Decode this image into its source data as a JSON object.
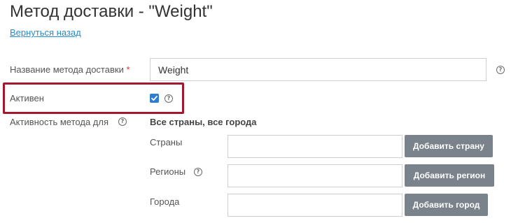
{
  "page": {
    "title": "Метод доставки - \"Weight\"",
    "back_link": "Вернуться назад"
  },
  "form": {
    "name": {
      "label": "Название метода доставки",
      "required_mark": "*",
      "value": "Weight"
    },
    "active": {
      "label": "Активен",
      "checked": true
    },
    "scope": {
      "label": "Активность метода для",
      "value": "Все страны, все города"
    },
    "countries": {
      "label": "Страны",
      "value": "",
      "button": "Добавить страну"
    },
    "regions": {
      "label": "Регионы",
      "value": "",
      "button": "Добавить регион"
    },
    "cities": {
      "label": "Города",
      "value": "",
      "button": "Добавить город"
    }
  },
  "icons": {
    "help": "question-circle-icon",
    "help_glyph": "?",
    "checkbox": "check-icon"
  },
  "colors": {
    "link": "#2a89c9",
    "required": "#d9333f",
    "checkbox": "#2f7dd3",
    "button": "#7a838b",
    "highlight": "#a3172f"
  }
}
